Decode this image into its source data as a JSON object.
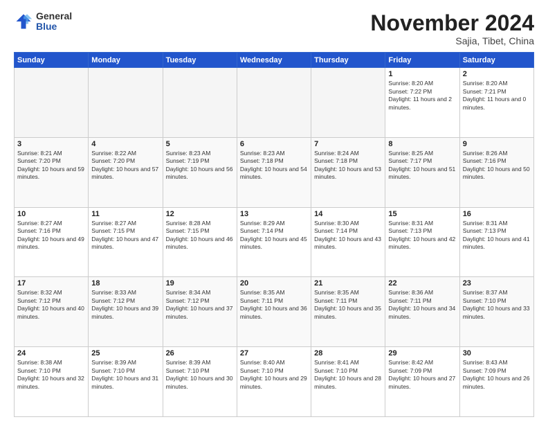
{
  "logo": {
    "general": "General",
    "blue": "Blue"
  },
  "header": {
    "month": "November 2024",
    "location": "Sajia, Tibet, China"
  },
  "weekdays": [
    "Sunday",
    "Monday",
    "Tuesday",
    "Wednesday",
    "Thursday",
    "Friday",
    "Saturday"
  ],
  "weeks": [
    [
      {
        "day": "",
        "info": ""
      },
      {
        "day": "",
        "info": ""
      },
      {
        "day": "",
        "info": ""
      },
      {
        "day": "",
        "info": ""
      },
      {
        "day": "",
        "info": ""
      },
      {
        "day": "1",
        "info": "Sunrise: 8:20 AM\nSunset: 7:22 PM\nDaylight: 11 hours and 2 minutes."
      },
      {
        "day": "2",
        "info": "Sunrise: 8:20 AM\nSunset: 7:21 PM\nDaylight: 11 hours and 0 minutes."
      }
    ],
    [
      {
        "day": "3",
        "info": "Sunrise: 8:21 AM\nSunset: 7:20 PM\nDaylight: 10 hours and 59 minutes."
      },
      {
        "day": "4",
        "info": "Sunrise: 8:22 AM\nSunset: 7:20 PM\nDaylight: 10 hours and 57 minutes."
      },
      {
        "day": "5",
        "info": "Sunrise: 8:23 AM\nSunset: 7:19 PM\nDaylight: 10 hours and 56 minutes."
      },
      {
        "day": "6",
        "info": "Sunrise: 8:23 AM\nSunset: 7:18 PM\nDaylight: 10 hours and 54 minutes."
      },
      {
        "day": "7",
        "info": "Sunrise: 8:24 AM\nSunset: 7:18 PM\nDaylight: 10 hours and 53 minutes."
      },
      {
        "day": "8",
        "info": "Sunrise: 8:25 AM\nSunset: 7:17 PM\nDaylight: 10 hours and 51 minutes."
      },
      {
        "day": "9",
        "info": "Sunrise: 8:26 AM\nSunset: 7:16 PM\nDaylight: 10 hours and 50 minutes."
      }
    ],
    [
      {
        "day": "10",
        "info": "Sunrise: 8:27 AM\nSunset: 7:16 PM\nDaylight: 10 hours and 49 minutes."
      },
      {
        "day": "11",
        "info": "Sunrise: 8:27 AM\nSunset: 7:15 PM\nDaylight: 10 hours and 47 minutes."
      },
      {
        "day": "12",
        "info": "Sunrise: 8:28 AM\nSunset: 7:15 PM\nDaylight: 10 hours and 46 minutes."
      },
      {
        "day": "13",
        "info": "Sunrise: 8:29 AM\nSunset: 7:14 PM\nDaylight: 10 hours and 45 minutes."
      },
      {
        "day": "14",
        "info": "Sunrise: 8:30 AM\nSunset: 7:14 PM\nDaylight: 10 hours and 43 minutes."
      },
      {
        "day": "15",
        "info": "Sunrise: 8:31 AM\nSunset: 7:13 PM\nDaylight: 10 hours and 42 minutes."
      },
      {
        "day": "16",
        "info": "Sunrise: 8:31 AM\nSunset: 7:13 PM\nDaylight: 10 hours and 41 minutes."
      }
    ],
    [
      {
        "day": "17",
        "info": "Sunrise: 8:32 AM\nSunset: 7:12 PM\nDaylight: 10 hours and 40 minutes."
      },
      {
        "day": "18",
        "info": "Sunrise: 8:33 AM\nSunset: 7:12 PM\nDaylight: 10 hours and 39 minutes."
      },
      {
        "day": "19",
        "info": "Sunrise: 8:34 AM\nSunset: 7:12 PM\nDaylight: 10 hours and 37 minutes."
      },
      {
        "day": "20",
        "info": "Sunrise: 8:35 AM\nSunset: 7:11 PM\nDaylight: 10 hours and 36 minutes."
      },
      {
        "day": "21",
        "info": "Sunrise: 8:35 AM\nSunset: 7:11 PM\nDaylight: 10 hours and 35 minutes."
      },
      {
        "day": "22",
        "info": "Sunrise: 8:36 AM\nSunset: 7:11 PM\nDaylight: 10 hours and 34 minutes."
      },
      {
        "day": "23",
        "info": "Sunrise: 8:37 AM\nSunset: 7:10 PM\nDaylight: 10 hours and 33 minutes."
      }
    ],
    [
      {
        "day": "24",
        "info": "Sunrise: 8:38 AM\nSunset: 7:10 PM\nDaylight: 10 hours and 32 minutes."
      },
      {
        "day": "25",
        "info": "Sunrise: 8:39 AM\nSunset: 7:10 PM\nDaylight: 10 hours and 31 minutes."
      },
      {
        "day": "26",
        "info": "Sunrise: 8:39 AM\nSunset: 7:10 PM\nDaylight: 10 hours and 30 minutes."
      },
      {
        "day": "27",
        "info": "Sunrise: 8:40 AM\nSunset: 7:10 PM\nDaylight: 10 hours and 29 minutes."
      },
      {
        "day": "28",
        "info": "Sunrise: 8:41 AM\nSunset: 7:10 PM\nDaylight: 10 hours and 28 minutes."
      },
      {
        "day": "29",
        "info": "Sunrise: 8:42 AM\nSunset: 7:09 PM\nDaylight: 10 hours and 27 minutes."
      },
      {
        "day": "30",
        "info": "Sunrise: 8:43 AM\nSunset: 7:09 PM\nDaylight: 10 hours and 26 minutes."
      }
    ]
  ]
}
